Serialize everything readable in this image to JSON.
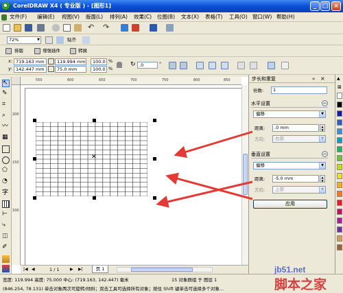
{
  "titlebar": {
    "title": "CorelDRAW X4 ( 专业版 ) - [图形1]",
    "min": "_",
    "max": "□",
    "close": "×"
  },
  "menus": [
    "文件(F)",
    "编辑(E)",
    "视图(V)",
    "版面(L)",
    "排列(A)",
    "效果(C)",
    "位图(B)",
    "文本(X)",
    "表格(T)",
    "工具(O)",
    "窗口(W)",
    "帮助(H)"
  ],
  "toolbar": {
    "zoom": "72%",
    "snap": "贴齐"
  },
  "plugin_bar": {
    "layout": "排版",
    "enhance": "增强插件",
    "convert": "转换"
  },
  "propbar": {
    "x": "719.163 mm",
    "y": "142.447 mm",
    "w": "119.994 mm",
    "h": "75.0 mm",
    "sx": "100.0",
    "sy": "100.0",
    "pct": "%",
    "angle": ".0",
    "deg": "°"
  },
  "ruler": {
    "h": [
      "550",
      "600",
      "650",
      "700",
      "750",
      "800",
      "850"
    ],
    "v": [
      "200",
      "150",
      "100"
    ]
  },
  "page_tab": {
    "nav": "1 / 1",
    "label": "页 1"
  },
  "docker": {
    "title": "步长和重复",
    "copies_label": "份数:",
    "copies_value": "1",
    "horizontal_title": "水平设置",
    "h_mode": "偏移",
    "h_distance_label": "距离:",
    "h_distance_value": ".0 mm",
    "h_direction_label": "方向:",
    "h_direction_value": "右部",
    "vertical_title": "垂直设置",
    "v_mode": "偏移",
    "v_distance_label": "距离:",
    "v_distance_value": "-5.0 mm",
    "v_direction_label": "方向:",
    "v_direction_value": "上部",
    "apply": "应用"
  },
  "status": {
    "line1_left": "宽度: 119.994 高度: 75.000 中心: (719.163, 142.447) 毫米",
    "line1_right": "15 对象群组 于 图层 1",
    "line2": "(846.254, 78.131)  单击对象两次可旋转/倾斜；双击工具可选择所有对象；按住 Shift 键单击可选择多个对象..."
  },
  "watermark": {
    "site": "jb51.net",
    "brand": "脚本之家"
  },
  "colors": {
    "accent": "#0a4fd6",
    "arrow": "#e53935",
    "background": "#ece9d8"
  },
  "palette": [
    "#ffffff",
    "#000000",
    "#1a1aa0",
    "#2f5cc9",
    "#3b8fd6",
    "#00a0c6",
    "#20b060",
    "#70c040",
    "#c8d820",
    "#f0e020",
    "#f0b020",
    "#f07820",
    "#e02020",
    "#c01060",
    "#a020a0",
    "#7030a0",
    "#d0a060",
    "#a06030"
  ]
}
